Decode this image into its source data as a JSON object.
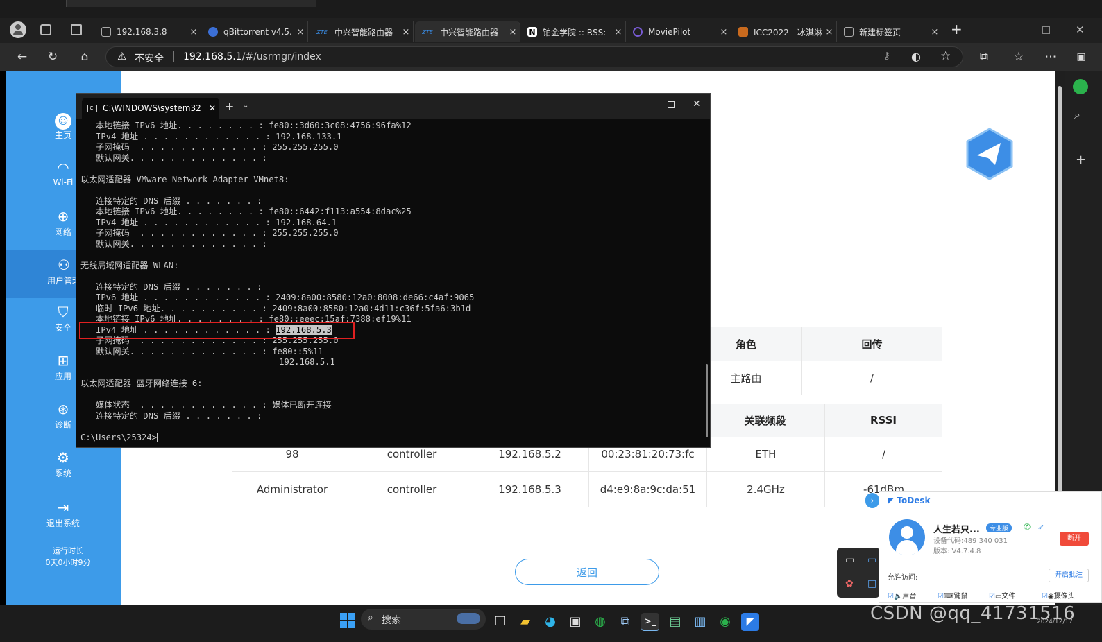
{
  "browser": {
    "tabs": [
      {
        "label": "192.168.3.8",
        "close": "×"
      },
      {
        "label": "qBittorrent v4.5.",
        "close": "×"
      },
      {
        "label": "中兴智能路由器",
        "close": "×",
        "icon": "ZTE"
      },
      {
        "label": "中兴智能路由器",
        "close": "×",
        "icon": "ZTE"
      },
      {
        "label": "铂金学院 :: RSS:",
        "close": "×",
        "icon": "N"
      },
      {
        "label": "MoviePilot",
        "close": "×"
      },
      {
        "label": "ICC2022—冰淇淋",
        "close": "×"
      },
      {
        "label": "新建标签页",
        "close": "×"
      }
    ],
    "new_tab": "+",
    "address": {
      "security_label": "不安全",
      "url_host": "192.168.5.1",
      "url_path": "/#/usrmgr/index"
    }
  },
  "sidebar": {
    "items": [
      {
        "label": "主页",
        "icon": "home-icon"
      },
      {
        "label": "Wi-Fi",
        "icon": "wifi-icon"
      },
      {
        "label": "网络",
        "icon": "globe-icon"
      },
      {
        "label": "用户管理",
        "icon": "users-icon"
      },
      {
        "label": "安全",
        "icon": "shield-icon"
      },
      {
        "label": "应用",
        "icon": "apps-icon"
      },
      {
        "label": "诊断",
        "icon": "diagnose-icon"
      },
      {
        "label": "系统",
        "icon": "gear-icon"
      },
      {
        "label": "退出系统",
        "icon": "logout-icon"
      }
    ],
    "runtime_label": "运行时长",
    "runtime_value": "0天0小时9分"
  },
  "table1": {
    "headers": [
      "角色",
      "回传"
    ],
    "row": [
      "主路由",
      "/"
    ]
  },
  "table2": {
    "headers": [
      "关联频段",
      "RSSI"
    ],
    "rows": [
      [
        "98",
        "controller",
        "192.168.5.2",
        "00:23:81:20:73:fc",
        "ETH",
        "/"
      ],
      [
        "Administrator",
        "controller",
        "192.168.5.3",
        "d4:e9:8a:9c:da:51",
        "2.4GHz",
        "-61dBm"
      ]
    ]
  },
  "back_button": "返回",
  "cmd": {
    "tab_title": "C:\\WINDOWS\\system32",
    "lines": [
      "   本地链接 IPv6 地址. . . . . . . . : fe80::3d60:3c08:4756:96fa%12",
      "   IPv4 地址 . . . . . . . . . . . . : 192.168.133.1",
      "   子网掩码  . . . . . . . . . . . . : 255.255.255.0",
      "   默认网关. . . . . . . . . . . . . :",
      "",
      "以太网适配器 VMware Network Adapter VMnet8:",
      "",
      "   连接特定的 DNS 后缀 . . . . . . . :",
      "   本地链接 IPv6 地址. . . . . . . . : fe80::6442:f113:a554:8dac%25",
      "   IPv4 地址 . . . . . . . . . . . . : 192.168.64.1",
      "   子网掩码  . . . . . . . . . . . . : 255.255.255.0",
      "   默认网关. . . . . . . . . . . . . :",
      "",
      "无线局域网适配器 WLAN:",
      "",
      "   连接特定的 DNS 后缀 . . . . . . . :",
      "   IPv6 地址 . . . . . . . . . . . . : 2409:8a00:8580:12a0:8008:de66:c4af:9065",
      "   临时 IPv6 地址. . . . . . . . . . : 2409:8a00:8580:12a0:4d11:c36f:5fa6:3b1d",
      "   本地链接 IPv6 地址. . . . . . . . : fe80::eeec:15af:7388:ef19%11",
      "   IPv4 地址 . . . . . . . . . . . . : ",
      "   子网掩码  . . . . . . . . . . . . : 255.255.255.0",
      "   默认网关. . . . . . . . . . . . . : fe80::5%11",
      "                                       192.168.5.1",
      "",
      "以太网适配器 蓝牙网络连接 6:",
      "",
      "   媒体状态  . . . . . . . . . . . . : 媒体已断开连接",
      "   连接特定的 DNS 后缀 . . . . . . . :",
      "",
      "C:\\Users\\25324>"
    ],
    "selected_ip": "192.168.5.3"
  },
  "todesk": {
    "brand": "ToDesk",
    "user_name": "人生若只...",
    "edition_badge": "专业版",
    "device_code": "设备代码:489 340 031",
    "version": "版本: V4.7.4.8",
    "disconnect": "断开",
    "allow_label": "允许访问:",
    "enable_approval": "开启批注",
    "permissions": [
      "声音",
      "键鼠",
      "文件",
      "摄像头"
    ]
  },
  "taskbar": {
    "search_label": "搜索",
    "date": "2024/12/17"
  },
  "watermark": "CSDN @qq_41731516",
  "colors": {
    "accent": "#3d9be9",
    "highlight_box": "#e02020",
    "terminal_bg": "#0c0c0c"
  }
}
